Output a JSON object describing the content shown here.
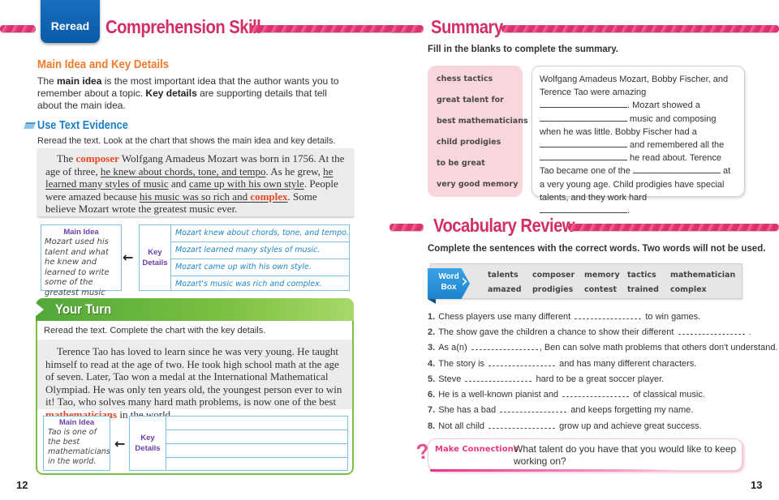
{
  "left_page": {
    "tab_label": "Reread",
    "title": "Comprehension Skill",
    "subheading": "Main Idea and Key Details",
    "intro": {
      "p1": "The ",
      "b1": "main idea",
      "p2": " is the most important idea that the author wants you to remember about a topic. ",
      "b2": "Key details",
      "p3": " are supporting details that tell about the main idea."
    },
    "evidence_heading": "Use Text Evidence",
    "evidence_instruction": "Reread the text. Look at the chart that shows the main idea and key details.",
    "passage": {
      "t1": "The ",
      "kw1": "composer",
      "t2": " Wolfgang Amadeus Mozart was born in 1756. At the age of three, ",
      "u1": "he knew about chords, tone, and tempo",
      "t3": ". As he grew, ",
      "u2": "he learned many styles of music",
      "t4": " and ",
      "u3": "came up with his own style",
      "t5": ". People were amazed because ",
      "u4a": "his music was so rich and ",
      "kw2": "complex",
      "t6": ". Some believe Mozart wrote the greatest music ever."
    },
    "chart1": {
      "main_idea_label": "Main Idea",
      "main_idea_text": "Mozart used his talent and what he knew and learned to write some of the greatest music ever.",
      "key_details_label_1": "Key",
      "key_details_label_2": "Details",
      "arrow": "←",
      "details": [
        "Mozart knew about chords, tone, and tempo.",
        "Mozart learned many styles of music.",
        "Mozart came up with his own style.",
        "Mozart's music was rich and complex."
      ]
    },
    "your_turn": {
      "title": "Your Turn",
      "instruction": "Reread the text. Complete the chart with the key details.",
      "passage_a": "Terence Tao has loved to learn since he was very young. He taught himself to read at the age of two. He took high school math at the age of seven. Later, Tao won a medal at the International Mathematical Olympiad. He was only ten years old, the youngest person ever to win it! Tao, who solves many hard math problems, is now one of the best ",
      "passage_kw": "mathematicians",
      "passage_b": " in the world.",
      "main_idea_label": "Main Idea",
      "main_idea_text": "Tao is one of the best mathematicians in the world.",
      "key_details_label_1": "Key",
      "key_details_label_2": "Details",
      "arrow": "←",
      "details": [
        "",
        "",
        "",
        ""
      ]
    },
    "page_number": "12"
  },
  "right_page": {
    "summary_title": "Summary",
    "summary_instruction": "Fill in the blanks to complete the summary.",
    "summary_words": [
      "chess tactics",
      "great talent for",
      "best mathematicians",
      "child prodigies",
      "to be great",
      "very good memory"
    ],
    "summary_text": {
      "s1": "Wolfgang Amadeus Mozart, Bobby Fischer, and Terence Tao were amazing ",
      "s2": ". Mozart showed a ",
      "s3": " music and composing when he was little. Bobby Fischer had a ",
      "s4": " and remembered all the ",
      "s5": " he read about. Terence Tao became one of the ",
      "s6": " at a very young age. Child prodigies have special talents, and they work hard ",
      "s7": "."
    },
    "vocab_title": "Vocabulary Review",
    "vocab_instruction": "Complete the sentences with the correct words. Two words will not be used.",
    "word_box_label_1": "Word",
    "word_box_label_2": "Box",
    "word_box_words": [
      [
        "talents",
        "composer",
        "memory",
        "tactics",
        "mathematician"
      ],
      [
        "amazed",
        "prodigies",
        "contest",
        "trained",
        "complex"
      ]
    ],
    "questions": [
      {
        "num": "1.",
        "before": "Chess players use many different",
        "after": "to win games."
      },
      {
        "num": "2.",
        "before": "The show gave the children a chance to show their different",
        "after": "."
      },
      {
        "num": "3.",
        "before": "As a(n)",
        "after": ", Ben can solve math problems that others don't understand."
      },
      {
        "num": "4.",
        "before": "The story is",
        "after": "and has many different characters."
      },
      {
        "num": "5.",
        "before": "Steve",
        "after": "hard to be a great soccer player."
      },
      {
        "num": "6.",
        "before": "He is a well-known pianist and",
        "after": "of classical music."
      },
      {
        "num": "7.",
        "before": "She has a bad",
        "after": "and keeps forgetting my name."
      },
      {
        "num": "8.",
        "before": "Not all child",
        "after": "grow up and achieve great success."
      }
    ],
    "make_connections_label": "Make Connections",
    "make_connections_text": "What talent do you have that you would like to keep working on?",
    "page_number": "13"
  },
  "colors": {
    "title_pink": "#d42e67",
    "reread_blue": "#0a5aa8",
    "orange": "#f07a2a",
    "evidence_blue": "#1b7ec6",
    "your_turn_green": "#7cc142",
    "key_detail_blue": "#1f86c8",
    "label_purple": "#6b3fa8",
    "summary_pink_bg": "#f9d6dc"
  }
}
